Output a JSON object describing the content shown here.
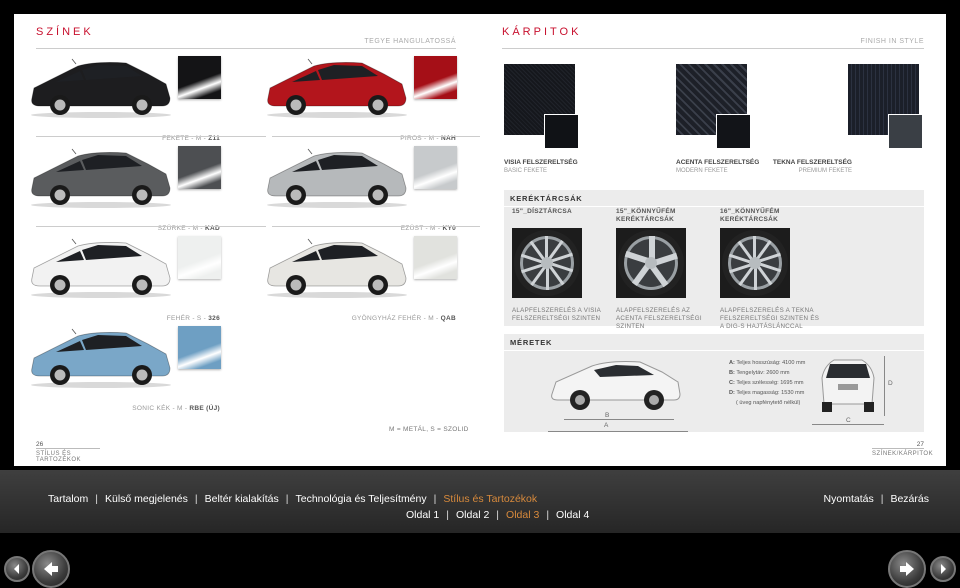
{
  "colors": {
    "section_title": "TEGYE HANGULATOSSÁ",
    "title": "SZÍNEK",
    "items": [
      {
        "name": "FEKETE - M -",
        "code": "Z11",
        "body": "#1d1d1f",
        "swatch": "#141416"
      },
      {
        "name": "PIROS - M -",
        "code": "NAH",
        "body": "#b3151c",
        "swatch": "#a50f17"
      },
      {
        "name": "SZÜRKE - M -",
        "code": "KAD",
        "body": "#5a5c5e",
        "swatch": "#4d4f52"
      },
      {
        "name": "EZÜST - M -",
        "code": "KY0",
        "body": "#b6b9bb",
        "swatch": "#c7cacc"
      },
      {
        "name": "FEHÉR - S -",
        "code": "326",
        "body": "#f2f2f2",
        "swatch": "#eef0ef"
      },
      {
        "name": "GYÖNGYHÁZ FEHÉR - M -",
        "code": "QAB",
        "body": "#e7e6e2",
        "swatch": "#e1e2de"
      },
      {
        "name": "SONIC KÉK - M -",
        "code": "RBE (ÚJ)",
        "body": "#7aa7c8",
        "swatch": "#6e9fc3"
      }
    ],
    "legend": "M = METÁL, S = SZOLID",
    "page_number": "26",
    "page_section": "STÍLUS ÉS TARTOZÉKOK"
  },
  "upholstery": {
    "title": "KÁRPITOK",
    "section_title": "FINISH IN STYLE",
    "fabrics": [
      {
        "name": "VISIA FELSZERELTSÉG",
        "sub": "BASIC FEKETE",
        "big": "#15171c",
        "small": "#101216"
      },
      {
        "name": "ACENTA FELSZERELTSÉG",
        "sub": "MODERN FEKETE",
        "big": "#1d2028",
        "small": "#121418"
      },
      {
        "name": "TEKNA FELSZERELTSÉG",
        "sub": "PREMIUM FEKETE",
        "big": "#1b1f29",
        "small": "#3a3f45"
      }
    ]
  },
  "wheels": {
    "title": "KERÉKTÁRCSÁK",
    "items": [
      {
        "title": "15\"_DÍSZTÁRCSA",
        "desc": "ALAPFELSZERELÉS A VISIA FELSZERELTSÉGI SZINTEN"
      },
      {
        "title": "15\"_KÖNNYŰFÉM KERÉKTÁRCSÁK",
        "desc": "ALAPFELSZERELÉS AZ ACENTA FELSZERELTSÉGI SZINTEN"
      },
      {
        "title": "16\"_KÖNNYŰFÉM KERÉKTÁRCSÁK",
        "desc": "ALAPFELSZERELÉS A TEKNA FELSZERELTSÉGI SZINTEN ÉS A DIG-S HAJTÁSLÁNCCAL"
      }
    ]
  },
  "dimensions": {
    "title": "MÉRETEK",
    "specs": [
      {
        "key": "A:",
        "text": "Teljes hosszúság: 4100 mm"
      },
      {
        "key": "B:",
        "text": "Tengelytáv: 2600 mm"
      },
      {
        "key": "C:",
        "text": "Teljes szélesség: 1695 mm"
      },
      {
        "key": "D:",
        "text": "Teljes magasság: 1530 mm"
      },
      {
        "key": "",
        "text": "( üveg napfénytető nélkül)"
      }
    ],
    "labels": {
      "a": "A",
      "b": "B",
      "c": "C",
      "d": "D"
    },
    "page_number": "27",
    "page_section": "SZÍNEK/KÁRPITOK"
  },
  "menu": {
    "items": [
      "Tartalom",
      "Külső megjelenés",
      "Beltér kialakítás",
      "Technológia és Teljesítmény",
      "Stílus és Tartozékok"
    ],
    "active_item": "Stílus és Tartozékok",
    "right_items": [
      "Nyomtatás",
      "Bezárás"
    ],
    "pages": [
      "Oldal 1",
      "Oldal 2",
      "Oldal 3",
      "Oldal 4"
    ],
    "active_page": "Oldal 3",
    "active_color": "#d88a3c"
  },
  "nav": {
    "prev_icon": "arrow-left-icon",
    "next_icon": "arrow-right-icon"
  }
}
